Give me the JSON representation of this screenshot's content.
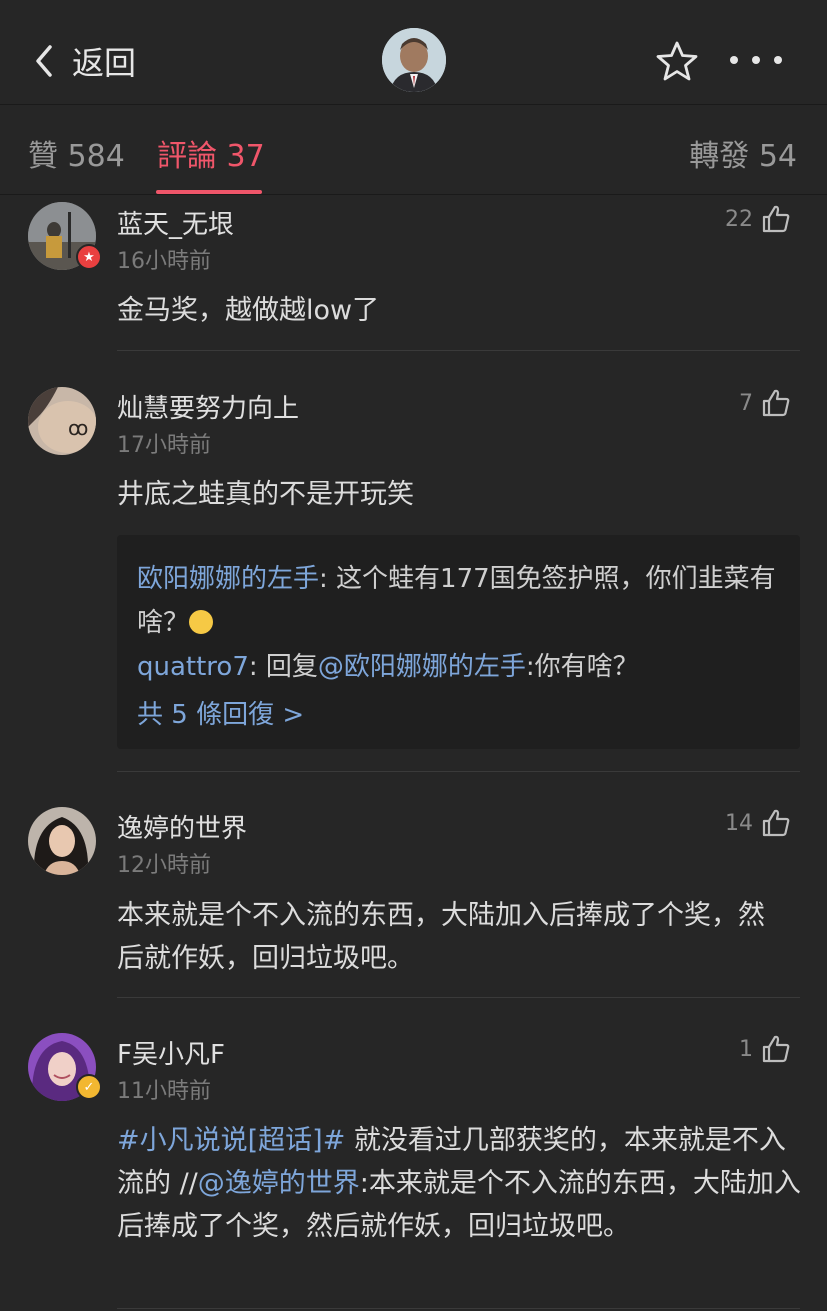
{
  "header": {
    "back_label": "返回"
  },
  "tabs": [
    {
      "label": "贊 584"
    },
    {
      "label": "評論 37"
    },
    {
      "label": "轉發 54"
    }
  ],
  "comments": [
    {
      "name": "蓝天_无垠",
      "time": "16小時前",
      "likes": "22",
      "text": "金马奖，越做越low了"
    },
    {
      "name": "灿慧要努力向上",
      "time": "17小時前",
      "likes": "7",
      "text": "井底之蛙真的不是开玩笑",
      "replies": [
        {
          "user": "欧阳娜娜的左手",
          "text": ": 这个蛙有177国免签护照，你们韭菜有啥？"
        },
        {
          "user": "quattro7",
          "text": ": 回复",
          "mention": "@欧阳娜娜的左手",
          "text2": ":你有啥？"
        }
      ],
      "more_replies": "共 5 條回復 >"
    },
    {
      "name": "逸婷的世界",
      "time": "12小時前",
      "likes": "14",
      "text": "本来就是个不入流的东西，大陆加入后捧成了个奖，然后就作妖，回归垃圾吧。"
    },
    {
      "name": "F吴小凡F",
      "time": "11小時前",
      "likes": "1",
      "topic": "#小凡说说[超话]#",
      "text_a": " 就没看过几部获奖的，本来就是不入流的 //",
      "mention": "@逸婷的世界",
      "text_b": ":本来就是个不入流的东西，大陆加入后捧成了个奖，然后就作妖，回归垃圾吧。"
    }
  ]
}
